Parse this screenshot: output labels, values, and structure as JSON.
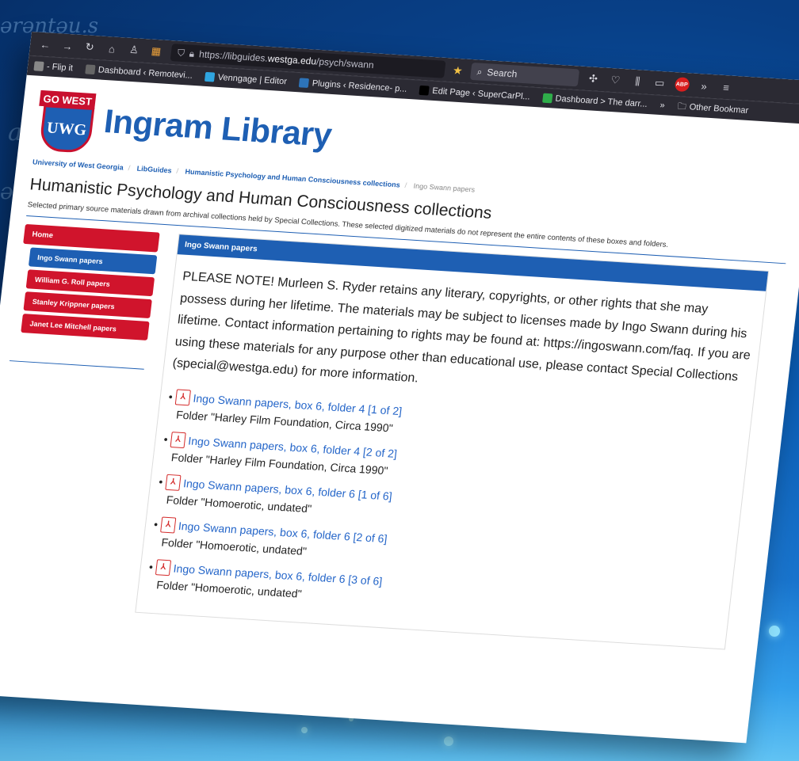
{
  "browser": {
    "url_prefix": "https://libguides.",
    "url_domain": "westga.edu",
    "url_path": "/psych/swann",
    "search_placeholder": "Search",
    "adblock_label": "ABP",
    "overflow_label": "»",
    "bookmarks": [
      {
        "label": "- Flip it",
        "color": "#888888"
      },
      {
        "label": "Dashboard ‹ Remotevi...",
        "color": "#666666"
      },
      {
        "label": "Venngage | Editor",
        "color": "#2fa5e0"
      },
      {
        "label": "Plugins ‹ Residence- p...",
        "color": "#2d73b8"
      },
      {
        "label": "Edit Page ‹ SuperCarPl...",
        "color": "#000000"
      },
      {
        "label": "Dashboard > The darr...",
        "color": "#2fae4a"
      }
    ],
    "other_bookmarks": "Other Bookmar"
  },
  "header": {
    "logo_ribbon": "GO WEST",
    "logo_text": "UWG",
    "title": "Ingram Library"
  },
  "breadcrumb": [
    "University of West Georgia",
    "LibGuides",
    "Humanistic Psychology and Human Consciousness collections",
    "Ingo Swann papers"
  ],
  "guide": {
    "title": "Humanistic Psychology and Human Consciousness collections",
    "description": "Selected primary source materials drawn from archival collections held by Special Collections. These selected digitized materials do not represent the entire contents of these boxes and folders."
  },
  "sidebar": {
    "home": "Home",
    "items": [
      "Ingo Swann papers",
      "William G. Roll papers",
      "Stanley Krippner papers",
      "Janet Lee Mitchell papers"
    ],
    "active_index": 0
  },
  "content": {
    "heading": "Ingo Swann papers",
    "note": "PLEASE NOTE! Murleen S. Ryder retains any literary, copyrights, or other rights that she may possess during her lifetime. The materials may be subject to licenses made by Ingo Swann during his lifetime. Contact information pertaining to rights may be found at: https://ingoswann.com/faq. If you are using these materials for any purpose other than educational use, please contact Special Collections (special@westga.edu) for more information.",
    "items": [
      {
        "link": "Ingo Swann papers, box 6, folder 4 [1 of 2]",
        "folder": "Folder \"Harley Film Foundation, Circa 1990\""
      },
      {
        "link": "Ingo Swann papers, box 6, folder 4 [2 of 2]",
        "folder": "Folder \"Harley Film Foundation, Circa 1990\""
      },
      {
        "link": "Ingo Swann papers, box 6, folder 6 [1 of 6]",
        "folder": "Folder \"Homoerotic, undated\""
      },
      {
        "link": "Ingo Swann papers, box 6, folder 6 [2 of 6]",
        "folder": "Folder \"Homoerotic, undated\""
      },
      {
        "link": "Ingo Swann papers, box 6, folder 6 [3 of 6]",
        "folder": "Folder \"Homoerotic, undated\""
      }
    ]
  }
}
